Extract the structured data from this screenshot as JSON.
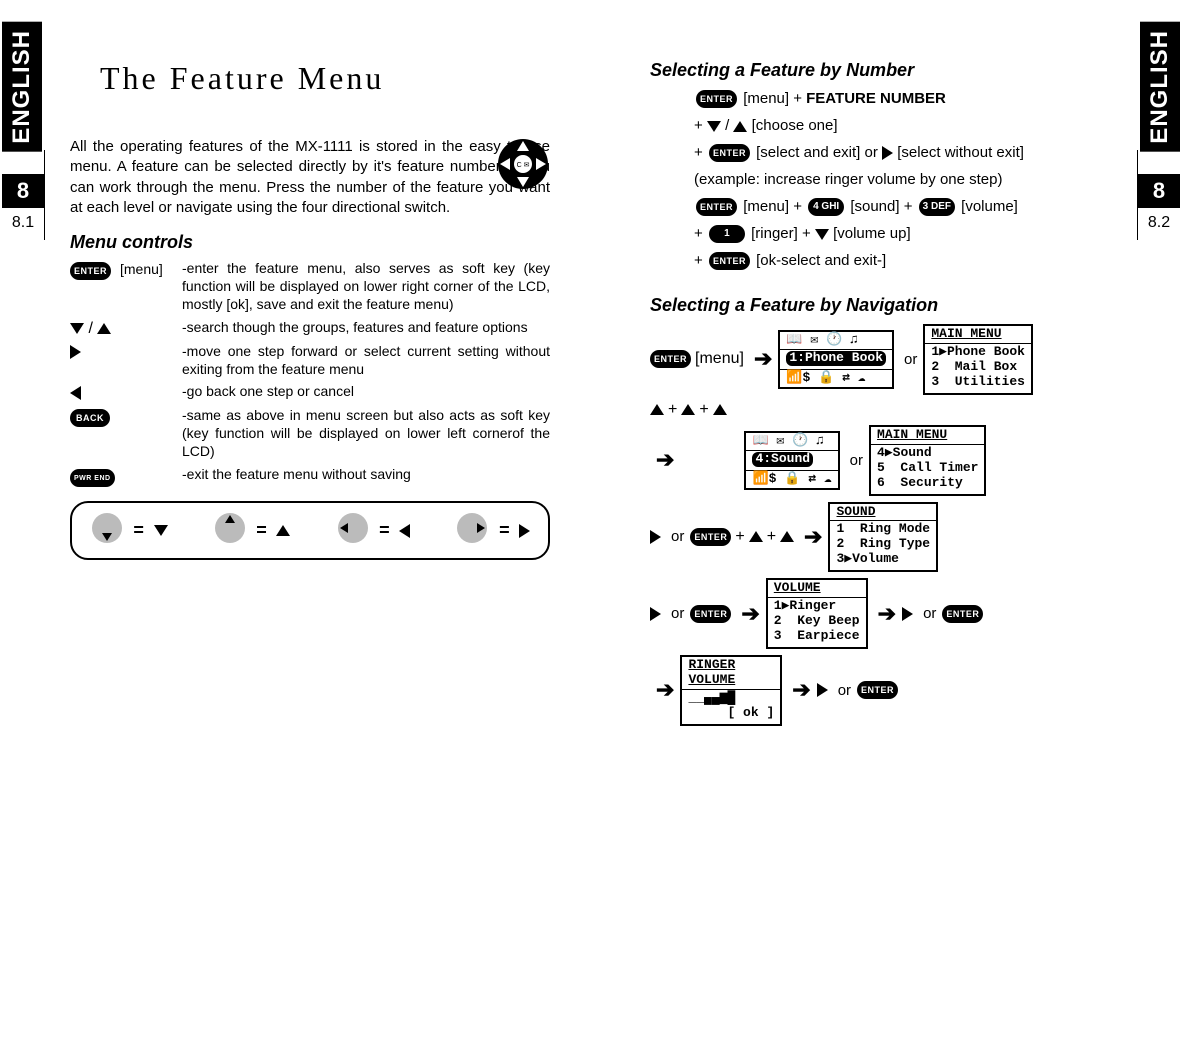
{
  "tabs": {
    "left": "ENGLISH",
    "right": "ENGLISH"
  },
  "chapter": {
    "left_num": "8",
    "right_num": "8",
    "left_page": "8.1",
    "right_page": "8.2"
  },
  "title": "The Feature Menu",
  "intro": "All the operating features of the MX-1111 is stored in the easy to use menu. A feature can be selected directly by it's feature number or you can work through the menu. Press the number of the feature you want at each level or navigate using the four directional switch.",
  "subheads": {
    "menu_controls": "Menu controls",
    "sel_by_number": "Selecting a Feature by Number",
    "sel_by_nav": "Selecting a Feature by Navigation"
  },
  "controls": {
    "menu": {
      "icon_text": "ENTER",
      "label": "[menu]",
      "desc": "-enter the feature menu, also serves as soft key (key function will be displayed on lower right corner of the LCD, mostly [ok], save and exit the feature menu)"
    },
    "updown": {
      "label": "",
      "desc": "-search though the groups, features and feature options"
    },
    "right": {
      "label": "",
      "desc": "-move one step forward or select current setting without exiting from the feature menu"
    },
    "left": {
      "label": "",
      "desc": "-go back one step or cancel"
    },
    "back": {
      "icon_text": "BACK",
      "label": "",
      "desc": "-same as above in menu screen but also acts as soft key (key function will be displayed on lower left cornerof the LCD)"
    },
    "pwr": {
      "icon_text": "PWR END",
      "label": "",
      "desc": "-exit the feature menu without saving"
    }
  },
  "legend_eq": "=",
  "sel_num": {
    "l1_pre": "[menu] + ",
    "l1_feat": "FEATURE NUMBER",
    "l2": "[choose one]",
    "l3a": "[select and exit] or",
    "l3b": "[select without exit]",
    "l4": "(example: increase ringer volume by one step)",
    "l5_menu": "[menu] +",
    "l5_sound": "[sound] +",
    "l5_vol": "[volume]",
    "l6_ringer": "[ringer] +",
    "l6_volup": "[volume up]",
    "l7": "[ok-select and exit-]",
    "key4": "4 GHI",
    "key3": "3 DEF",
    "key1": "1"
  },
  "nav": {
    "menu_label": "[menu]",
    "or": "or",
    "plus": "+",
    "lcd_phonebook": {
      "head": "📖 ✉ 🕐 ♫",
      "sel": "1:Phone Book",
      "foot": "📶$ 🔒 ⇄ ☁"
    },
    "lcd_mainmenu1": {
      "title": "MAIN MENU",
      "body": "1▶Phone Book\n2  Mail Box\n3  Utilities"
    },
    "lcd_sound": {
      "head": "📖 ✉ 🕐 ♫",
      "sel": "4:Sound",
      "foot": "📶$ 🔒 ⇄ ☁"
    },
    "lcd_mainmenu2": {
      "title": "MAIN MENU",
      "body": "4▶Sound\n5  Call Timer\n6  Security"
    },
    "lcd_soundmenu": {
      "title": "SOUND",
      "body": "1  Ring Mode\n2  Ring Type\n3▶Volume"
    },
    "lcd_volume": {
      "title": "VOLUME",
      "body": "1▶Ringer\n2  Key Beep\n3  Earpiece"
    },
    "lcd_ringer": {
      "title": "RINGER\nVOLUME",
      "body": "__▄▄▆█\n     [ ok ]"
    }
  }
}
